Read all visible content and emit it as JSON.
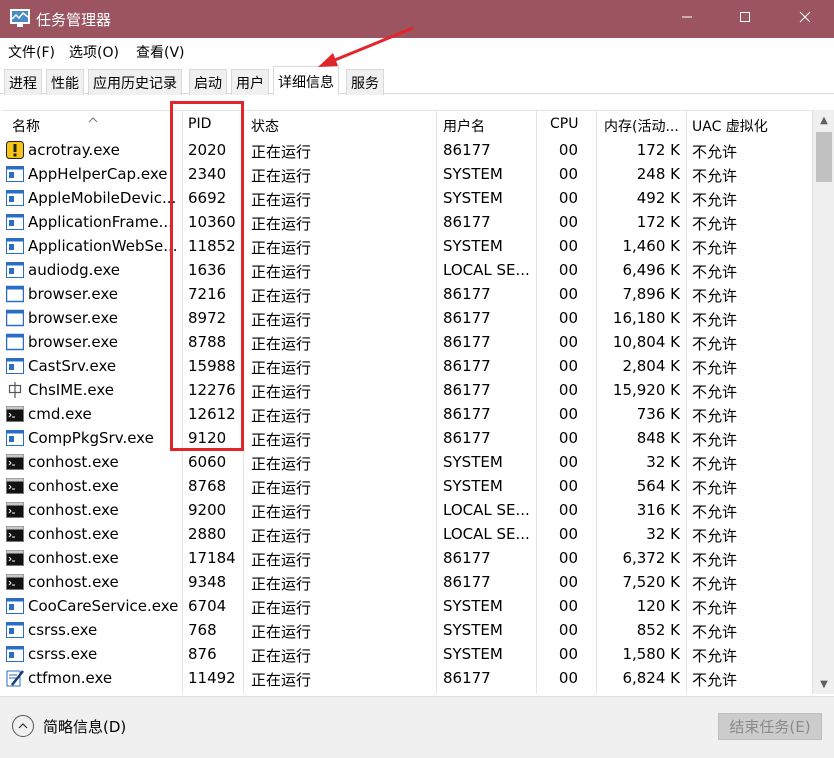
{
  "window": {
    "title": "任务管理器"
  },
  "menu": [
    "文件(F)",
    "选项(O)",
    "查看(V)"
  ],
  "tabs": [
    "进程",
    "性能",
    "应用历史记录",
    "启动",
    "用户",
    "详细信息",
    "服务"
  ],
  "active_tab": "详细信息",
  "columns": {
    "name": "名称",
    "pid": "PID",
    "status": "状态",
    "user": "用户名",
    "cpu": "CPU",
    "memory": "内存(活动...",
    "uac": "UAC 虚拟化"
  },
  "rows": [
    {
      "name": "acrotray.exe",
      "icon": "acrotray-icon",
      "pid": "2020",
      "status": "正在运行",
      "user": "86177",
      "cpu": "00",
      "memory": "172 K",
      "uac": "不允许"
    },
    {
      "name": "AppHelperCap.exe",
      "icon": "app-window-icon",
      "pid": "2340",
      "status": "正在运行",
      "user": "SYSTEM",
      "cpu": "00",
      "memory": "248 K",
      "uac": "不允许"
    },
    {
      "name": "AppleMobileDevic...",
      "icon": "app-window-icon",
      "pid": "6692",
      "status": "正在运行",
      "user": "SYSTEM",
      "cpu": "00",
      "memory": "492 K",
      "uac": "不允许"
    },
    {
      "name": "ApplicationFrame...",
      "icon": "app-window-icon",
      "pid": "10360",
      "status": "正在运行",
      "user": "86177",
      "cpu": "00",
      "memory": "172 K",
      "uac": "不允许"
    },
    {
      "name": "ApplicationWebSe...",
      "icon": "app-window-icon",
      "pid": "11852",
      "status": "正在运行",
      "user": "SYSTEM",
      "cpu": "00",
      "memory": "1,460 K",
      "uac": "不允许"
    },
    {
      "name": "audiodg.exe",
      "icon": "app-window-icon",
      "pid": "1636",
      "status": "正在运行",
      "user": "LOCAL SE...",
      "cpu": "00",
      "memory": "6,496 K",
      "uac": "不允许"
    },
    {
      "name": "browser.exe",
      "icon": "browser-icon",
      "pid": "7216",
      "status": "正在运行",
      "user": "86177",
      "cpu": "00",
      "memory": "7,896 K",
      "uac": "不允许"
    },
    {
      "name": "browser.exe",
      "icon": "browser-icon",
      "pid": "8972",
      "status": "正在运行",
      "user": "86177",
      "cpu": "00",
      "memory": "16,180 K",
      "uac": "不允许"
    },
    {
      "name": "browser.exe",
      "icon": "browser-icon",
      "pid": "8788",
      "status": "正在运行",
      "user": "86177",
      "cpu": "00",
      "memory": "10,804 K",
      "uac": "不允许"
    },
    {
      "name": "CastSrv.exe",
      "icon": "app-window-icon",
      "pid": "15988",
      "status": "正在运行",
      "user": "86177",
      "cpu": "00",
      "memory": "2,804 K",
      "uac": "不允许"
    },
    {
      "name": "ChsIME.exe",
      "icon": "ime-icon",
      "pid": "12276",
      "status": "正在运行",
      "user": "86177",
      "cpu": "00",
      "memory": "15,920 K",
      "uac": "不允许"
    },
    {
      "name": "cmd.exe",
      "icon": "console-icon",
      "pid": "12612",
      "status": "正在运行",
      "user": "86177",
      "cpu": "00",
      "memory": "736 K",
      "uac": "不允许"
    },
    {
      "name": "CompPkgSrv.exe",
      "icon": "app-window-icon",
      "pid": "9120",
      "status": "正在运行",
      "user": "86177",
      "cpu": "00",
      "memory": "848 K",
      "uac": "不允许"
    },
    {
      "name": "conhost.exe",
      "icon": "console-icon",
      "pid": "6060",
      "status": "正在运行",
      "user": "SYSTEM",
      "cpu": "00",
      "memory": "32 K",
      "uac": "不允许"
    },
    {
      "name": "conhost.exe",
      "icon": "console-icon",
      "pid": "8768",
      "status": "正在运行",
      "user": "SYSTEM",
      "cpu": "00",
      "memory": "564 K",
      "uac": "不允许"
    },
    {
      "name": "conhost.exe",
      "icon": "console-icon",
      "pid": "9200",
      "status": "正在运行",
      "user": "LOCAL SE...",
      "cpu": "00",
      "memory": "316 K",
      "uac": "不允许"
    },
    {
      "name": "conhost.exe",
      "icon": "console-icon",
      "pid": "2880",
      "status": "正在运行",
      "user": "LOCAL SE...",
      "cpu": "00",
      "memory": "32 K",
      "uac": "不允许"
    },
    {
      "name": "conhost.exe",
      "icon": "console-icon",
      "pid": "17184",
      "status": "正在运行",
      "user": "86177",
      "cpu": "00",
      "memory": "6,372 K",
      "uac": "不允许"
    },
    {
      "name": "conhost.exe",
      "icon": "console-icon",
      "pid": "9348",
      "status": "正在运行",
      "user": "86177",
      "cpu": "00",
      "memory": "7,520 K",
      "uac": "不允许"
    },
    {
      "name": "CooCareService.exe",
      "icon": "app-window-icon",
      "pid": "6704",
      "status": "正在运行",
      "user": "SYSTEM",
      "cpu": "00",
      "memory": "120 K",
      "uac": "不允许"
    },
    {
      "name": "csrss.exe",
      "icon": "app-window-icon",
      "pid": "768",
      "status": "正在运行",
      "user": "SYSTEM",
      "cpu": "00",
      "memory": "852 K",
      "uac": "不允许"
    },
    {
      "name": "csrss.exe",
      "icon": "app-window-icon",
      "pid": "876",
      "status": "正在运行",
      "user": "SYSTEM",
      "cpu": "00",
      "memory": "1,580 K",
      "uac": "不允许"
    },
    {
      "name": "ctfmon.exe",
      "icon": "ctfmon-icon",
      "pid": "11492",
      "status": "正在运行",
      "user": "86177",
      "cpu": "00",
      "memory": "6,824 K",
      "uac": "不允许"
    }
  ],
  "footer": {
    "fewer_details": "简略信息(D)",
    "end_task": "结束任务(E)"
  },
  "colors": {
    "titlebar": "#9b5460",
    "annotation": "#e1262b"
  }
}
